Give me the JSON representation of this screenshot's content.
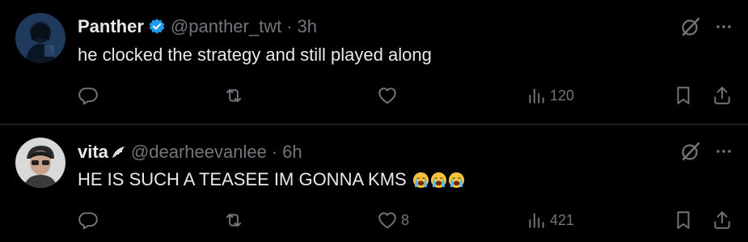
{
  "tweets": [
    {
      "name": "Panther",
      "handle": "@panther_twt",
      "separator": "·",
      "time": "3h",
      "text": "he clocked the strategy and still played along",
      "verified": true,
      "replies": "",
      "retweets": "",
      "likes": "",
      "views": "120"
    },
    {
      "name": "vita",
      "handle": "@dearheevanlee",
      "separator": "·",
      "time": "6h",
      "text": "HE IS SUCH A TEASEE IM GONNA KMS",
      "emojis": [
        "loudly-crying-face",
        "loudly-crying-face",
        "loudly-crying-face"
      ],
      "verified": false,
      "replies": "",
      "retweets": "",
      "likes": "8",
      "views": "421"
    }
  ],
  "colors": {
    "background": "#000000",
    "text": "#e7e9ea",
    "muted": "#71767b",
    "verified": "#1d9bf0",
    "divider": "#2f3336"
  }
}
